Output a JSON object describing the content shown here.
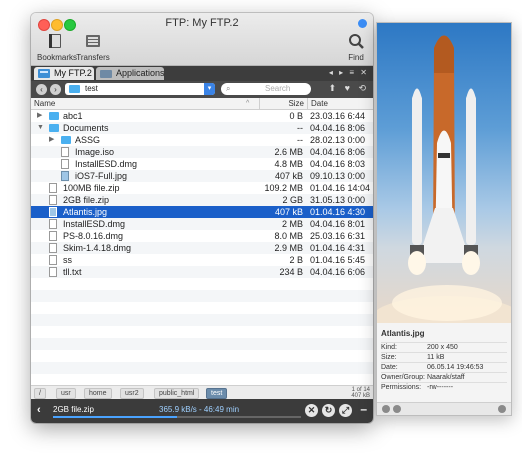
{
  "window": {
    "title": "FTP: My FTP.2"
  },
  "toolbar": {
    "bookmarks": "Bookmarks",
    "transfers": "Transfers",
    "find": "Find"
  },
  "tabs": [
    {
      "label": "My FTP.2",
      "active": true
    },
    {
      "label": "Applications",
      "active": false
    }
  ],
  "nav": {
    "path": "test",
    "search_placeholder": "Search"
  },
  "columns": {
    "name": "Name",
    "size": "Size",
    "date": "Date"
  },
  "files": [
    {
      "name": "abc1",
      "size": "0 B",
      "date": "23.03.16 6:44",
      "kind": "folder",
      "depth": 0,
      "disclosure": "closed"
    },
    {
      "name": "Documents",
      "size": "--",
      "date": "04.04.16 8:06",
      "kind": "folder",
      "depth": 0,
      "disclosure": "open"
    },
    {
      "name": "ASSG",
      "size": "--",
      "date": "28.02.13 0:00",
      "kind": "folder",
      "depth": 1,
      "disclosure": "closed"
    },
    {
      "name": "Image.iso",
      "size": "2.6 MB",
      "date": "04.04.16 8:06",
      "kind": "doc",
      "depth": 1,
      "disclosure": ""
    },
    {
      "name": "InstallESD.dmg",
      "size": "4.8 MB",
      "date": "04.04.16 8:03",
      "kind": "doc",
      "depth": 1,
      "disclosure": ""
    },
    {
      "name": "iOS7-Full.jpg",
      "size": "407 kB",
      "date": "09.10.13 0:00",
      "kind": "img",
      "depth": 1,
      "disclosure": ""
    },
    {
      "name": "100MB file.zip",
      "size": "109.2 MB",
      "date": "01.04.16 14:04",
      "kind": "doc",
      "depth": 0,
      "disclosure": ""
    },
    {
      "name": "2GB file.zip",
      "size": "2 GB",
      "date": "31.05.13 0:00",
      "kind": "doc",
      "depth": 0,
      "disclosure": ""
    },
    {
      "name": "Atlantis.jpg",
      "size": "407 kB",
      "date": "01.04.16 4:30",
      "kind": "img",
      "depth": 0,
      "disclosure": "",
      "selected": true
    },
    {
      "name": "InstallESD.dmg",
      "size": "2 MB",
      "date": "04.04.16 8:01",
      "kind": "doc",
      "depth": 0,
      "disclosure": ""
    },
    {
      "name": "PS-8.0.16.dmg",
      "size": "8.0 MB",
      "date": "25.03.16 6:31",
      "kind": "doc",
      "depth": 0,
      "disclosure": ""
    },
    {
      "name": "Skim-1.4.18.dmg",
      "size": "2.9 MB",
      "date": "01.04.16 4:31",
      "kind": "doc",
      "depth": 0,
      "disclosure": ""
    },
    {
      "name": "ss",
      "size": "2 B",
      "date": "01.04.16 5:45",
      "kind": "doc",
      "depth": 0,
      "disclosure": ""
    },
    {
      "name": "tll.txt",
      "size": "234 B",
      "date": "04.04.16 6:06",
      "kind": "doc",
      "depth": 0,
      "disclosure": ""
    }
  ],
  "breadcrumb": [
    "/",
    "usr",
    "home",
    "usr2",
    "public_html",
    "test"
  ],
  "count": {
    "items": "1 of 14",
    "size": "407 kB"
  },
  "transfer": {
    "file": "2GB file.zip",
    "rate": "365.9 kB/s - 46:49 min",
    "progress": 0.5
  },
  "preview": {
    "title": "Atlantis.jpg",
    "props": [
      {
        "label": "Kind:",
        "value": "200 x 450"
      },
      {
        "label": "Size:",
        "value": "11 kB"
      },
      {
        "label": "Date:",
        "value": "06.05.14 19:46:53"
      },
      {
        "label": "Owner/Group:",
        "value": "Naarak/staff"
      },
      {
        "label": "Permissions:",
        "value": "-rw-------"
      }
    ]
  },
  "colors": {
    "accent": "#1a5fc9",
    "folder": "#4ab0f0",
    "dark_bar": "#3b3b3b"
  }
}
